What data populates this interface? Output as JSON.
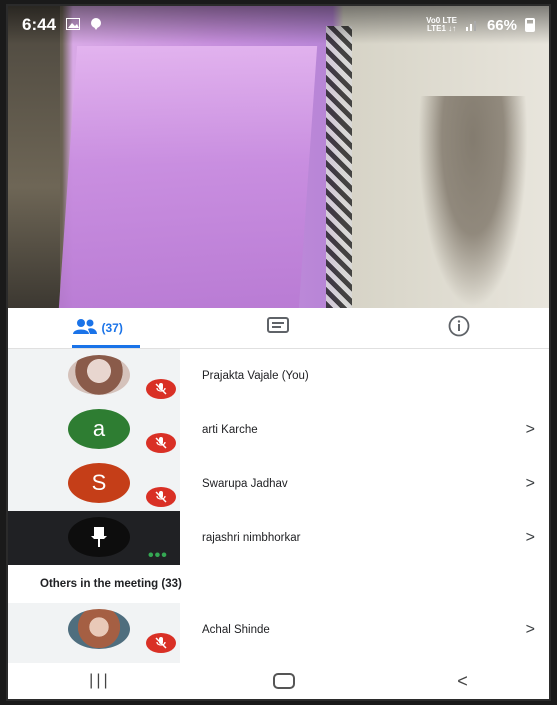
{
  "status": {
    "time": "6:44",
    "network_top": "Vo0 LTE",
    "network_bottom": "LTE1 ↓↑",
    "battery": "66%"
  },
  "tabs": {
    "people_count": "(37)"
  },
  "participants": [
    {
      "name": "Prajakta Vajale (You)",
      "avatar_letter": "",
      "avatar_color": "#b58f83",
      "muted": true,
      "chevron": ""
    },
    {
      "name": "arti Karche",
      "avatar_letter": "a",
      "avatar_color": "#2e7d32",
      "muted": true,
      "chevron": ">"
    },
    {
      "name": "Swarupa Jadhav",
      "avatar_letter": "S",
      "avatar_color": "#c53e18",
      "muted": true,
      "chevron": ">"
    },
    {
      "name": "rajashri nimbhorkar",
      "avatar_letter": "",
      "avatar_color": "#111111",
      "muted": false,
      "chevron": ">"
    }
  ],
  "others": {
    "heading": "Others in the meeting (33)",
    "items": [
      {
        "name": "Achal Shinde",
        "chevron": ">"
      }
    ]
  },
  "colors": {
    "accent": "#1a73e8",
    "mute_red": "#d93025",
    "speaking_green": "#34a853"
  },
  "icons": [
    "image-icon",
    "chat-bubble-icon",
    "people-icon",
    "chat-icon",
    "info-icon",
    "mic-off-icon",
    "pin-icon",
    "recents-icon",
    "home-icon",
    "back-icon"
  ]
}
